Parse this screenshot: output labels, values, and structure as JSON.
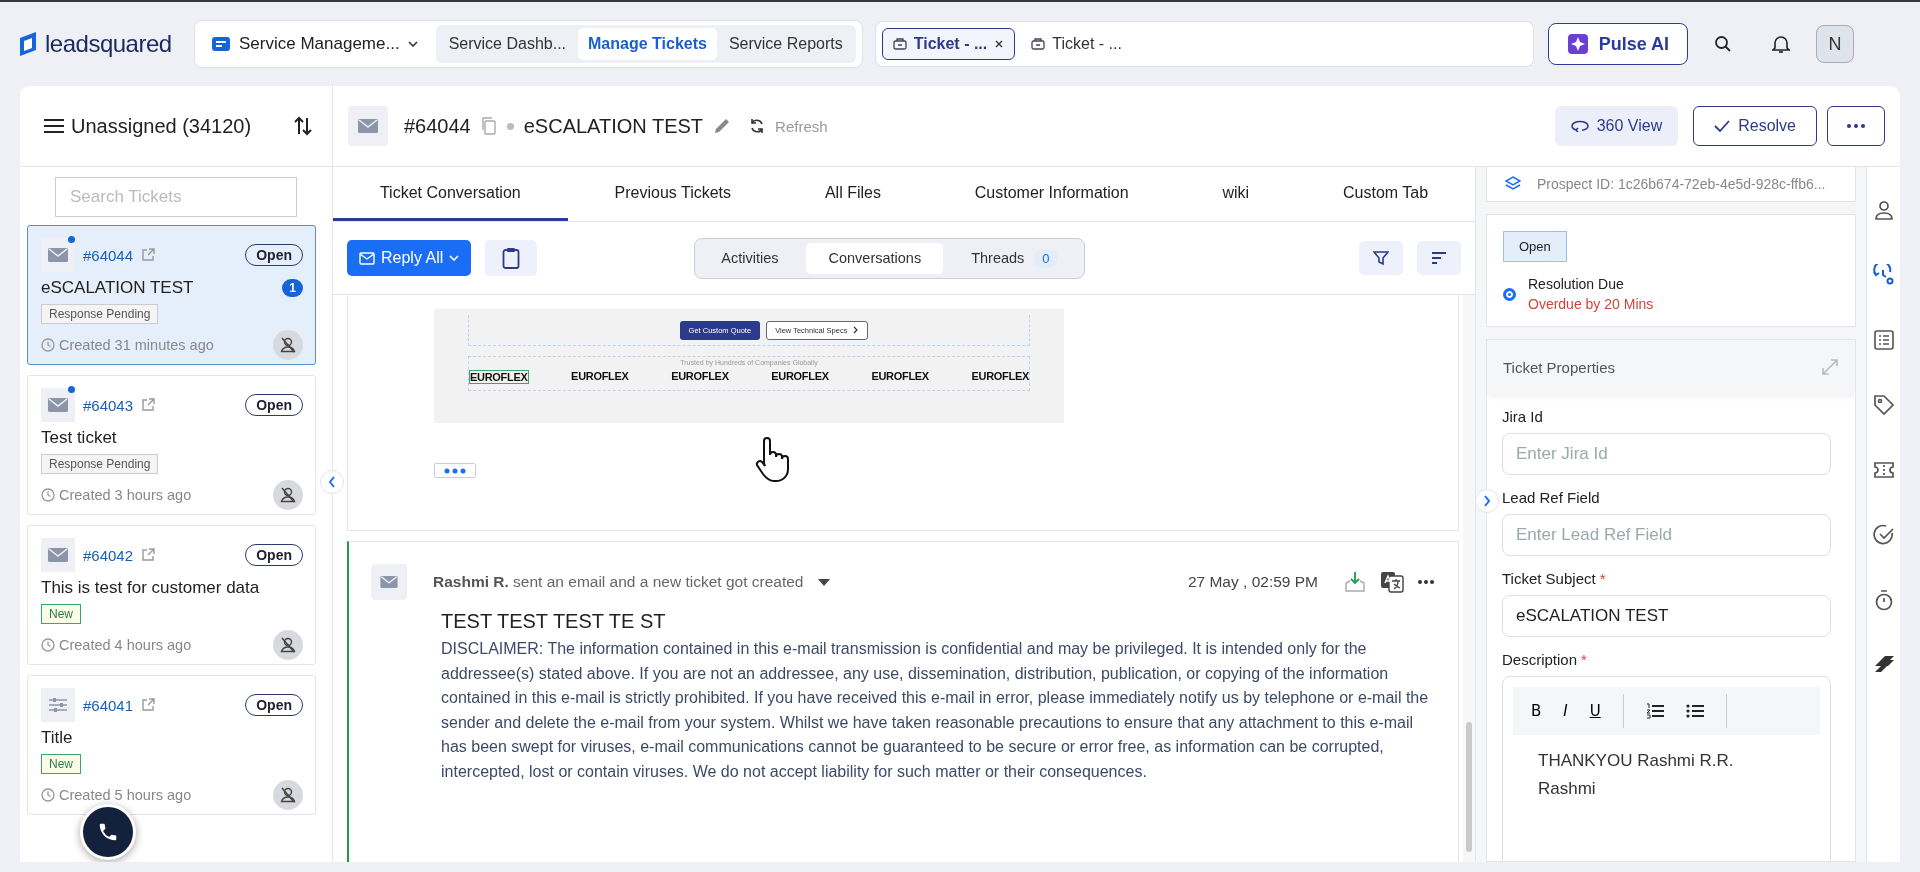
{
  "topbar": {
    "logo": "leadsquared",
    "module": "Service Manageme...",
    "nav": [
      {
        "label": "Service Dashb...",
        "selected": false
      },
      {
        "label": "Manage Tickets",
        "selected": true
      },
      {
        "label": "Service Reports",
        "selected": false
      }
    ],
    "ticket_tabs": [
      {
        "label": "Ticket - ...",
        "selected": true,
        "closable": true
      },
      {
        "label": "Ticket - ...",
        "selected": false,
        "closable": false
      }
    ],
    "pulse_button": "Pulse AI",
    "avatar": "N"
  },
  "ticket_list": {
    "title": "Unassigned (34120)",
    "search_placeholder": "Search Tickets",
    "tickets": [
      {
        "kind": "email",
        "unread": true,
        "id": "#64044",
        "status": "Open",
        "subject": "eSCALATION TEST",
        "count": "1",
        "tag": {
          "label": "Response Pending",
          "kind": "pending"
        },
        "created": "Created 31 minutes ago",
        "selected": true
      },
      {
        "kind": "email",
        "unread": true,
        "id": "#64043",
        "status": "Open",
        "subject": "Test ticket",
        "tag": {
          "label": "Response Pending",
          "kind": "pending"
        },
        "created": "Created 3 hours ago",
        "selected": false
      },
      {
        "kind": "email",
        "unread": false,
        "id": "#64042",
        "status": "Open",
        "subject": "This is test for customer data",
        "tag": {
          "label": "New",
          "kind": "new"
        },
        "created": "Created 4 hours ago",
        "selected": false
      },
      {
        "kind": "form",
        "unread": false,
        "id": "#64041",
        "status": "Open",
        "subject": "Title",
        "tag": {
          "label": "New",
          "kind": "new"
        },
        "created": "Created 5 hours ago",
        "selected": false
      }
    ]
  },
  "ticket": {
    "id": "#64044",
    "title": "eSCALATION TEST",
    "refresh": "Refresh",
    "view360": "360 View",
    "resolve": "Resolve"
  },
  "tabs": [
    {
      "label": "Ticket Conversation",
      "selected": true
    },
    {
      "label": "Previous Tickets",
      "selected": false
    },
    {
      "label": "All Files",
      "selected": false
    },
    {
      "label": "Customer Information",
      "selected": false
    },
    {
      "label": "wiki",
      "selected": false
    },
    {
      "label": "Custom Tab",
      "selected": false
    }
  ],
  "toolbar": {
    "reply": "Reply All",
    "segments": [
      {
        "label": "Activities",
        "selected": false
      },
      {
        "label": "Conversations",
        "selected": true
      },
      {
        "label": "Threads",
        "selected": false,
        "count": "0"
      }
    ]
  },
  "email_preview": {
    "buttons": [
      "Get Custom Quote",
      "View Technical Specs"
    ],
    "trusted": "Trusted by Hundreds of Companies Globally",
    "logos": [
      "EUROFLEX",
      "EUROFLEX",
      "EUROFLEX",
      "EUROFLEX",
      "EUROFLEX",
      "EUROFLEX"
    ]
  },
  "message": {
    "header": "**Rashmi R.** sent an email and a new ticket got created",
    "time": "27 May , 02:59 PM",
    "subject": "TEST TEST TEST TE ST",
    "body": "DISCLAIMER: The information contained in this e-mail transmission is confidential and may be privileged. It is intended only for the addressee(s) stated above. If you are not an addressee, any use, dissemination, distribution, publication, or copying of the information contained in this e-mail is strictly prohibited. If you have received this e-mail in error, please immediately notify us by telephone or e-mail the sender and delete the e-mail from your system. Whilst we have taken reasonable precautions to ensure that any attachment to this e-mail has been swept for viruses, e-mail communications cannot be guaranteed to be secure or error free, as information can be corrupted, intercepted, lost or contain viruses. We do not accept liability for such matter or their consequences."
  },
  "right_panel": {
    "prospect": "Prospect ID: 1c26b674-72eb-4e5d-928c-ffb6...",
    "status": "Open",
    "sla": {
      "label": "Resolution Due",
      "detail": "Overdue by 20 Mins",
      "checked": true
    },
    "properties": {
      "title": "Ticket Properties",
      "fields": [
        {
          "label": "Jira Id",
          "placeholder": "Enter Jira Id"
        },
        {
          "label": "Lead Ref Field",
          "placeholder": "Enter Lead Ref Field"
        },
        {
          "label": "Ticket Subject",
          "required_mark": "*",
          "value": "eSCALATION TEST"
        }
      ],
      "description": {
        "label": "Description",
        "required_mark": "*",
        "tools": [
          "B",
          "I",
          "U"
        ],
        "lines": [
          "THANKYOU Rashmi R.R.",
          "Rashmi"
        ]
      }
    }
  },
  "rail": [
    {
      "kind": "person",
      "selected": false
    },
    {
      "kind": "sla",
      "selected": true
    },
    {
      "kind": "list",
      "selected": false
    },
    {
      "kind": "tag",
      "selected": false
    },
    {
      "kind": "ticket",
      "selected": false
    },
    {
      "kind": "check",
      "selected": false
    },
    {
      "kind": "timer",
      "selected": false
    },
    {
      "kind": "jira",
      "selected": false
    }
  ]
}
